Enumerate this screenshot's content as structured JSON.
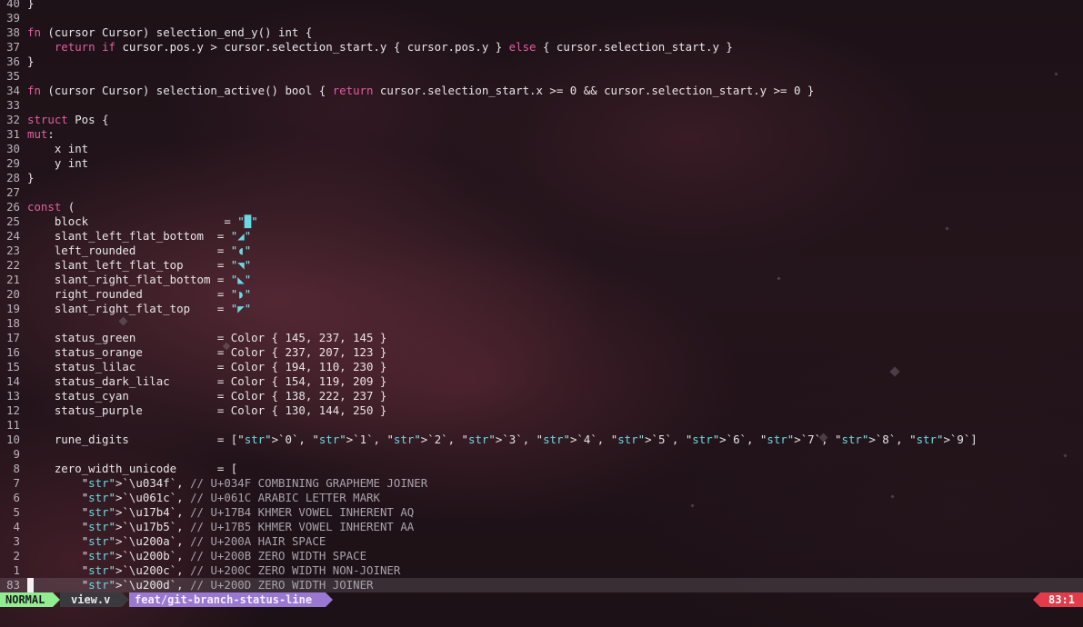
{
  "editor": {
    "filetype": "v",
    "colors": {
      "keyword": "#e05fa0",
      "string": "#8fe3ea",
      "comment": "#a9a2ab",
      "text": "#e8e6e8"
    },
    "lines": [
      {
        "num": "40",
        "text": "}"
      },
      {
        "num": "39",
        "text": ""
      },
      {
        "num": "38",
        "text": "fn (cursor Cursor) selection_end_y() int {"
      },
      {
        "num": "37",
        "text": "    return if cursor.pos.y > cursor.selection_start.y { cursor.pos.y } else { cursor.selection_start.y }"
      },
      {
        "num": "36",
        "text": "}"
      },
      {
        "num": "35",
        "text": ""
      },
      {
        "num": "34",
        "text": "fn (cursor Cursor) selection_active() bool { return cursor.selection_start.x >= 0 && cursor.selection_start.y >= 0 }"
      },
      {
        "num": "33",
        "text": ""
      },
      {
        "num": "32",
        "text": "struct Pos {"
      },
      {
        "num": "31",
        "text": "mut:"
      },
      {
        "num": "30",
        "text": "    x int"
      },
      {
        "num": "29",
        "text": "    y int"
      },
      {
        "num": "28",
        "text": "}"
      },
      {
        "num": "27",
        "text": ""
      },
      {
        "num": "26",
        "text": "const ("
      },
      {
        "num": "25",
        "text": "    block                    = \"█\""
      },
      {
        "num": "24",
        "text": "    slant_left_flat_bottom  = \"◢\""
      },
      {
        "num": "23",
        "text": "    left_rounded            = \"◖\""
      },
      {
        "num": "22",
        "text": "    slant_left_flat_top     = \"◥\""
      },
      {
        "num": "21",
        "text": "    slant_right_flat_bottom = \"◣\""
      },
      {
        "num": "20",
        "text": "    right_rounded           = \"◗\""
      },
      {
        "num": "19",
        "text": "    slant_right_flat_top    = \"◤\""
      },
      {
        "num": "18",
        "text": ""
      },
      {
        "num": "17",
        "text": "    status_green            = Color { 145, 237, 145 }"
      },
      {
        "num": "16",
        "text": "    status_orange           = Color { 237, 207, 123 }"
      },
      {
        "num": "15",
        "text": "    status_lilac            = Color { 194, 110, 230 }"
      },
      {
        "num": "14",
        "text": "    status_dark_lilac       = Color { 154, 119, 209 }"
      },
      {
        "num": "13",
        "text": "    status_cyan             = Color { 138, 222, 237 }"
      },
      {
        "num": "12",
        "text": "    status_purple           = Color { 130, 144, 250 }"
      },
      {
        "num": "11",
        "text": ""
      },
      {
        "num": "10",
        "text": "    rune_digits             = [`0`, `1`, `2`, `3`, `4`, `5`, `6`, `7`, `8`, `9`]"
      },
      {
        "num": "9",
        "text": ""
      },
      {
        "num": "8",
        "text": "    zero_width_unicode      = ["
      },
      {
        "num": "7",
        "text": "        `\\u034f`, // U+034F COMBINING GRAPHEME JOINER"
      },
      {
        "num": "6",
        "text": "        `\\u061c`, // U+061C ARABIC LETTER MARK"
      },
      {
        "num": "5",
        "text": "        `\\u17b4`, // U+17B4 KHMER VOWEL INHERENT AQ"
      },
      {
        "num": "4",
        "text": "        `\\u17b5`, // U+17B5 KHMER VOWEL INHERENT AA"
      },
      {
        "num": "3",
        "text": "        `\\u200a`, // U+200A HAIR SPACE"
      },
      {
        "num": "2",
        "text": "        `\\u200b`, // U+200B ZERO WIDTH SPACE"
      },
      {
        "num": "1",
        "text": "        `\\u200c`, // U+200C ZERO WIDTH NON-JOINER"
      },
      {
        "num": "83",
        "text": "        `\\u200d`, // U+200D ZERO WIDTH JOINER",
        "current": true
      }
    ]
  },
  "statusline": {
    "mode": "NORMAL",
    "file": "view.v",
    "branch": " feat/git-branch-status-line",
    "position": "83:1",
    "colors": {
      "mode": "#91ed91",
      "file": "#3a3a3e",
      "branch": "#9a77d1",
      "position": "#e23b4a"
    }
  }
}
